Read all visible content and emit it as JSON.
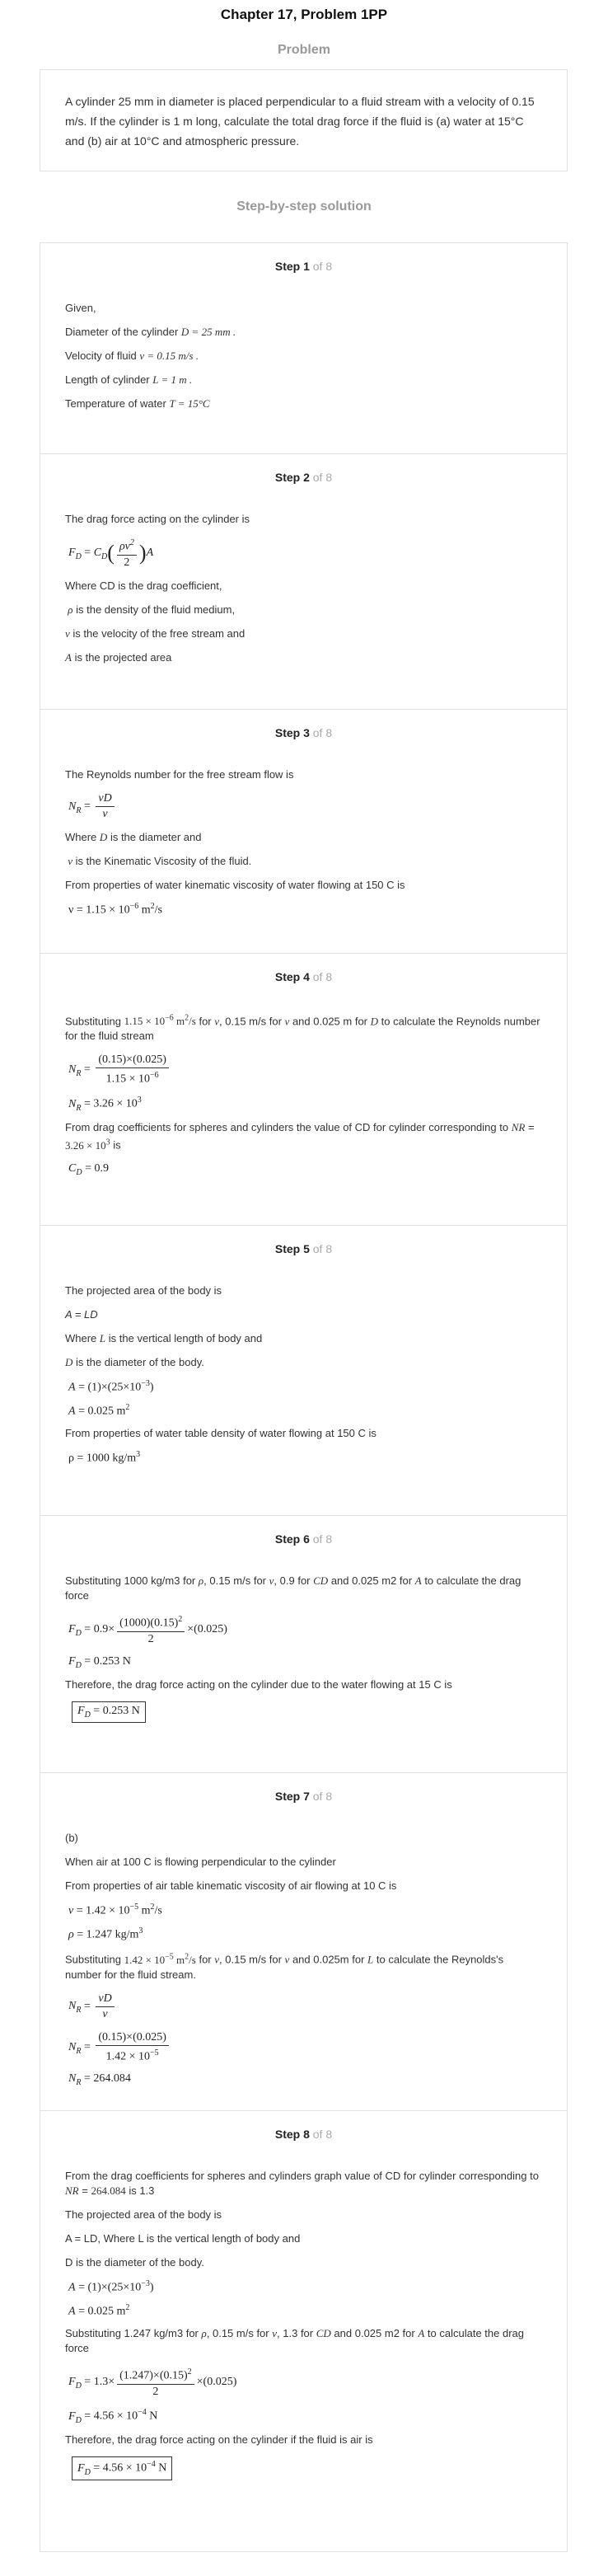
{
  "header": {
    "title": "Chapter 17, Problem 1PP"
  },
  "problem": {
    "heading": "Problem",
    "text": "A cylinder 25 mm in diameter is placed perpendicular to a fluid stream with a velocity of 0.15 m/s. If the cylinder is 1 m long, calculate the total drag force if the fluid is (a) water at 15°C and (b) air at 10°C and atmospheric pressure."
  },
  "solution": {
    "heading": "Step-by-step solution"
  },
  "steps": [
    {
      "label": "Step 1",
      "of": "of 8",
      "given": "Given,",
      "l1": "Diameter of the cylinder",
      "e1": "D = 25 mm .",
      "l2": "Velocity of fluid",
      "e2": "v = 0.15 m/s .",
      "l3": "Length of cylinder",
      "e3": "L = 1 m .",
      "l4": "Temperature of water",
      "e4": "T = 15°C"
    },
    {
      "label": "Step 2",
      "of": "of 8",
      "intro": "The drag force acting on the cylinder is",
      "w1": "Where CD is the drag coefficient,",
      "w2": "is the density of the fluid medium,",
      "w3": "is the velocity of the free stream and",
      "w4": "is the projected area"
    },
    {
      "label": "Step 3",
      "of": "of 8",
      "intro": "The Reynolds number for the free stream flow is",
      "w1a": "Where",
      "w1b": "is the diameter and",
      "w2": "is the Kinematic Viscosity of the fluid.",
      "w3": "From properties of water kinematic viscosity of water flowing at 150 C is",
      "nu": "ν = 1.15 × 10"
    },
    {
      "label": "Step 4",
      "of": "of 8",
      "s1a": "Substituting",
      "s1b": "for",
      "s1c": ", 0.15 m/s for",
      "s1d": "and 0.025 m for",
      "s1e": "to calculate the Reynolds number for the fluid stream",
      "nr": "3.26 × 10",
      "t1": "From drag coefficients for spheres and cylinders the value of CD for cylinder corresponding to",
      "t1b": "is",
      "cd": "0.9"
    },
    {
      "label": "Step 5",
      "of": "of 8",
      "l1": "The projected area of the body is",
      "l2": "A = LD",
      "l3a": "Where",
      "l3b": "is the vertical length of body and",
      "l4": "is the diameter of the body.",
      "l5": "From properties of water table density of water flowing at 150 C is",
      "rho": "ρ = 1000 kg/m"
    },
    {
      "label": "Step 6",
      "of": "of 8",
      "s1": "Substituting 1000 kg/m3 for",
      "s1b": ", 0.15 m/s for",
      "s1c": ", 0.9 for",
      "s1d": "and 0.025 m2 for",
      "s1e": "to calculate the drag force",
      "fd": "0.253 N",
      "t1": "Therefore, the drag force acting on the cylinder due to the water flowing at 15 C is"
    },
    {
      "label": "Step 7",
      "of": "of 8",
      "b": "(b)",
      "l1": "When air at 100 C is flowing perpendicular to the cylinder",
      "l2": "From properties of air table kinematic viscosity of air flowing at 10 C is",
      "s1a": "Substituting",
      "s1b": "for",
      "s1c": ", 0.15 m/s for",
      "s1d": "and 0.025m for",
      "s1e": "to calculate the Reynolds's number for the fluid stream.",
      "nr": "264.084"
    },
    {
      "label": "Step 8",
      "of": "of 8",
      "l1": "From the drag coefficients for spheres and cylinders graph value of CD for cylinder corresponding to",
      "l1b": "is 1.3",
      "l2": "The projected area of the body is",
      "l3": "A = LD, Where L is the vertical length of body and",
      "l4": "D is the diameter of the body.",
      "s1": "Substituting 1.247 kg/m3 for",
      "s1b": ", 0.15 m/s for",
      "s1c": ", 1.3 for",
      "s1d": "and 0.025 m2 for",
      "s1e": "to calculate the drag force",
      "fd": "4.56 × 10",
      "t1": "Therefore, the drag force acting on the cylinder if the fluid is air is"
    }
  ]
}
